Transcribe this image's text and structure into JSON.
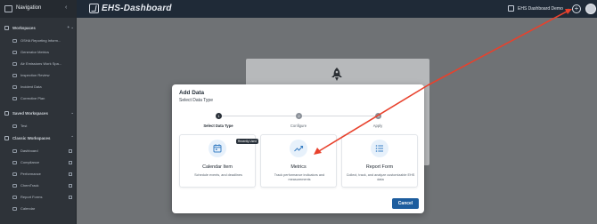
{
  "topbar": {
    "logo_text": "EHS-Dashboard",
    "tenant_name": "EHS Dashboard Demo",
    "plus_icon": "plus-circle-icon",
    "avatar_icon": "user-avatar-icon"
  },
  "sidebar": {
    "title": "Navigation",
    "sections": {
      "workspaces": "Workspaces",
      "saved": "Saved Workspaces",
      "classic": "Classic Workspaces"
    },
    "workspace_items": [
      {
        "label": "OSHA Reporting Inform..."
      },
      {
        "label": "Generator Metrics"
      },
      {
        "label": "Air Emissions Work Spa..."
      },
      {
        "label": "Inspection Review"
      },
      {
        "label": "Incident Data"
      },
      {
        "label": "Corrective Plan"
      }
    ],
    "saved_items": [
      {
        "label": "Test"
      }
    ],
    "classic_items": [
      {
        "label": "Dashboard"
      },
      {
        "label": "Compliance"
      },
      {
        "label": "Performance"
      },
      {
        "label": "ChemTrack"
      },
      {
        "label": "Report Forms"
      },
      {
        "label": "Calendar"
      }
    ]
  },
  "modal": {
    "title": "Add Data",
    "subtitle": "Select Data Type",
    "steps": [
      {
        "number": "1",
        "label": "Select Data Type",
        "state": "active"
      },
      {
        "number": "2",
        "label": "Configure",
        "state": "todo"
      },
      {
        "number": "3",
        "label": "Apply",
        "state": "todo"
      }
    ],
    "options": [
      {
        "title": "Calendar Item",
        "description": "Schedule events, and deadlines",
        "badge": "Recently Used",
        "icon": "calendar-icon"
      },
      {
        "title": "Metrics",
        "description": "Track performance indicators and measurements",
        "icon": "trend-line-icon"
      },
      {
        "title": "Report Form",
        "description": "Collect, track, and analyze customizable EHS data",
        "icon": "list-icon"
      }
    ],
    "cancel_label": "Cancel"
  },
  "colors": {
    "topbar": "#1f2a37",
    "sidebar": "#2e3339",
    "primary_button": "#1d5d9e",
    "annotation_arrow": "#e8412c"
  }
}
